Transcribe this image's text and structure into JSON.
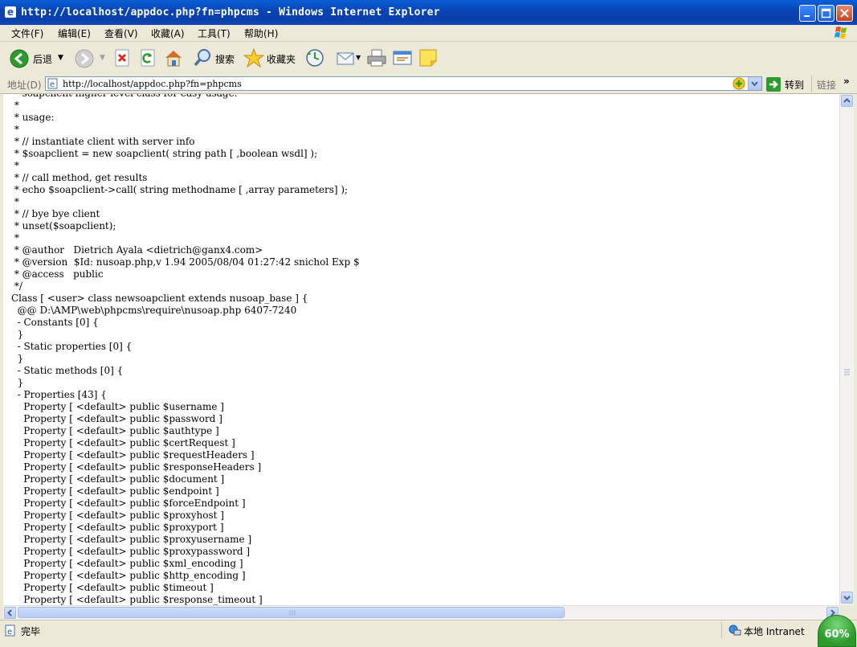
{
  "window": {
    "title": "http://localhost/appdoc.php?fn=phpcms - Windows Internet Explorer"
  },
  "menu": [
    "文件(F)",
    "编辑(E)",
    "查看(V)",
    "收藏(A)",
    "工具(T)",
    "帮助(H)"
  ],
  "toolbar": {
    "back_label": "后退",
    "search_label": "搜索",
    "favorites_label": "收藏夹"
  },
  "address": {
    "label": "地址(D)",
    "url": "http://localhost/appdoc.php?fn=phpcms",
    "go_label": "转到",
    "links_label": "链接"
  },
  "content": {
    "lines": [
      " * soapclient higher level class for easy usage.",
      " *",
      " * usage:",
      " *",
      " * // instantiate client with server info",
      " * $soapclient = new soapclient( string path [ ,boolean wsdl] );",
      " *",
      " * // call method, get results",
      " * echo $soapclient->call( string methodname [ ,array parameters] );",
      " *",
      " * // bye bye client",
      " * unset($soapclient);",
      " *",
      " * @author   Dietrich Ayala <dietrich@ganx4.com>",
      " * @version  $Id: nusoap.php,v 1.94 2005/08/04 01:27:42 snichol Exp $",
      " * @access   public",
      " */",
      "Class [ <user> class newsoapclient extends nusoap_base ] {",
      "  @@ D:\\AMP\\web\\phpcms\\require\\nusoap.php 6407-7240",
      "  - Constants [0] {",
      "  }",
      "  - Static properties [0] {",
      "  }",
      "  - Static methods [0] {",
      "  }",
      "  - Properties [43] {",
      "    Property [ <default> public $username ]",
      "    Property [ <default> public $password ]",
      "    Property [ <default> public $authtype ]",
      "    Property [ <default> public $certRequest ]",
      "    Property [ <default> public $requestHeaders ]",
      "    Property [ <default> public $responseHeaders ]",
      "    Property [ <default> public $document ]",
      "    Property [ <default> public $endpoint ]",
      "    Property [ <default> public $forceEndpoint ]",
      "    Property [ <default> public $proxyhost ]",
      "    Property [ <default> public $proxyport ]",
      "    Property [ <default> public $proxyusername ]",
      "    Property [ <default> public $proxypassword ]",
      "    Property [ <default> public $xml_encoding ]",
      "    Property [ <default> public $http_encoding ]",
      "    Property [ <default> public $timeout ]",
      "    Property [ <default> public $response_timeout ]"
    ]
  },
  "status": {
    "text": "完毕",
    "zone": "本地 Intranet",
    "zoom": "60%"
  },
  "colors": {
    "titlebar": "#0a47c0",
    "chrome": "#ece9d8",
    "content_bg": "#ffffff"
  }
}
